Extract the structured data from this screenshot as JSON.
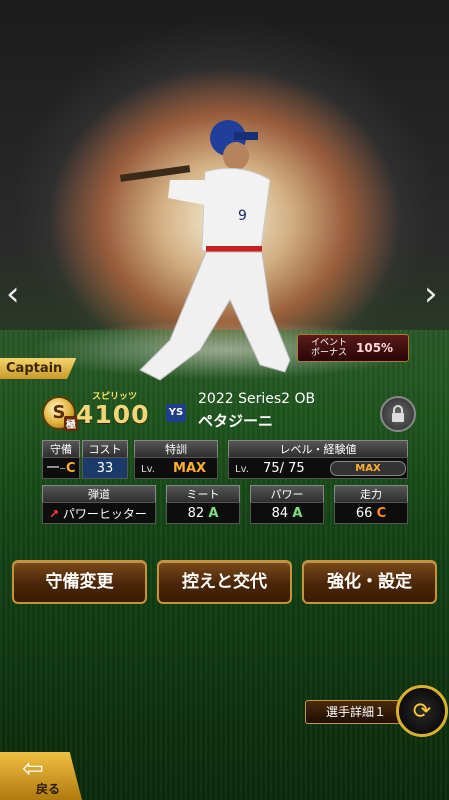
{
  "nav": {
    "prev_icon": "chevron-left-icon",
    "next_icon": "chevron-right-icon",
    "prev": "‹",
    "next": "›"
  },
  "captain_label": "Captain",
  "event_bonus": {
    "label": "イベント\nボーナス",
    "value": "105%"
  },
  "card": {
    "rank_letter": "S",
    "rank_label": "極",
    "spirits_label": "スピリッツ",
    "spirits_value": "4100",
    "team_logo": "YS",
    "series": "2022 Series2 OB",
    "player_name": "ペタジーニ"
  },
  "stats_top": {
    "position_label": "守備",
    "position_value_1": "一",
    "position_value_2": "C",
    "cost_label": "コスト",
    "cost_value": "33",
    "training_label": "特訓",
    "training_lv": "Lv.",
    "training_value": "MAX",
    "level_label": "レベル・経験値",
    "level_lv": "Lv.",
    "level_value": "75/ 75",
    "exp_value": "MAX"
  },
  "stats_bottom": {
    "trajectory_label": "弾道",
    "trajectory_value": "パワーヒッター",
    "meet_label": "ミート",
    "meet_value": "82",
    "meet_grade": "A",
    "power_label": "パワー",
    "power_value": "84",
    "power_grade": "A",
    "speed_label": "走力",
    "speed_value": "66",
    "speed_grade": "C"
  },
  "actions": [
    "守備変更",
    "控えと交代",
    "強化・設定"
  ],
  "detail_label": "選手詳細１",
  "back_label": "戻る",
  "colors": {
    "gold": "#ffb030",
    "grade_a": "#7ee07e",
    "grade_c": "#ff8c1a",
    "button_border": "#c8923a"
  }
}
